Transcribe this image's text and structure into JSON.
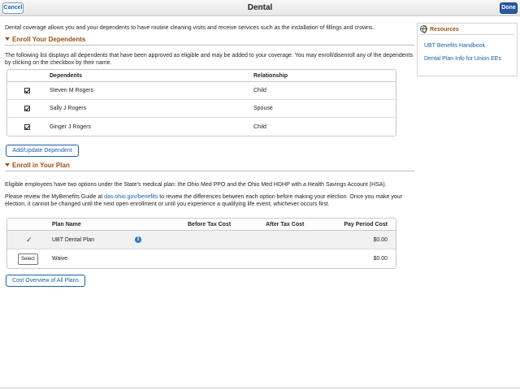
{
  "header": {
    "title": "Dental",
    "cancel_label": "Cancel",
    "done_label": "Done"
  },
  "intro": "Dental coverage allows you and your dependents to have routine cleaning visits and receive services such as the installation of fillings and crowns.",
  "enroll_dependents": {
    "heading": "Enroll Your Dependents",
    "description": "The following list displays all dependents that have been approved as eligible and may be added to your coverage. You may enroll/disenroll any of the dependents by clicking on the checkbox by their name.",
    "columns": {
      "dependents": "Dependents",
      "relationship": "Relationship"
    },
    "rows": [
      {
        "name": "Steven M Rogers",
        "relationship": "Child",
        "checked": true
      },
      {
        "name": "Sally J Rogers",
        "relationship": "Spouse",
        "checked": true
      },
      {
        "name": "Ginger J Rogers",
        "relationship": "Child",
        "checked": true
      }
    ],
    "add_button": "Add/Update Dependent"
  },
  "enroll_plan": {
    "heading": "Enroll in Your Plan",
    "para1": "Eligible employees have two options under the State's medical plan: the Ohio Med PPO and the Ohio Med HDHP with a Health Savings Account (HSA).",
    "para2_before": "Please review the MyBenefits Guide at ",
    "para2_link": "das.ohio.gov/benefits",
    "para2_after": " to review the differences between each option before making your election. Once you make your election, it cannot be changed until the next open enrollment or until you experience a qualifying life event; whichever occurs first.",
    "columns": {
      "plan_name": "Plan Name",
      "before_tax": "Before Tax Cost",
      "after_tax": "After Tax Cost",
      "pay_period": "Pay Period Cost"
    },
    "rows": [
      {
        "plan": "UBT Dental Plan",
        "before_tax": "",
        "after_tax": "",
        "pay_period": "$0.00",
        "selected": true
      },
      {
        "plan": "Waive",
        "before_tax": "",
        "after_tax": "",
        "pay_period": "$0.00",
        "selected": false,
        "select_label": "Select"
      }
    ],
    "overview_button": "Cost Overview of All Plans"
  },
  "resources": {
    "heading": "Resources",
    "links": [
      "UBT Benefits Handbook",
      "Dental Plan Info for Union EEs"
    ]
  },
  "colors": {
    "accent": "#9c4f13",
    "link": "#1a5da8",
    "primary_button": "#2a58a6"
  }
}
